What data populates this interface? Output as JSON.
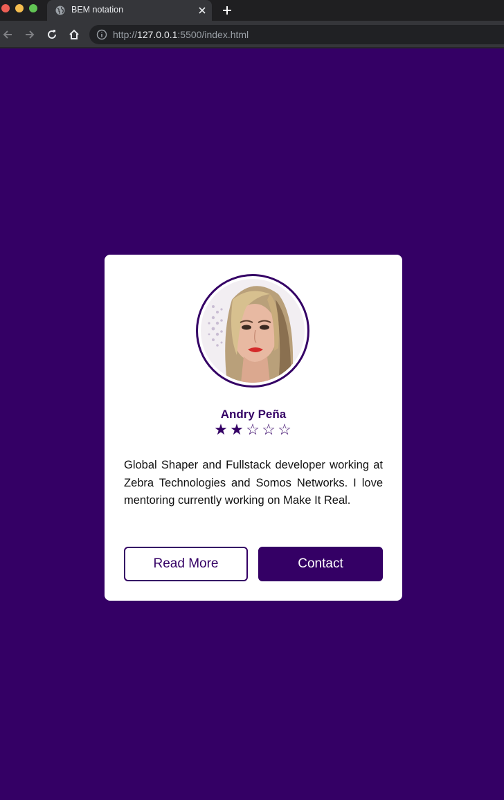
{
  "browser": {
    "tab_title": "BEM notation",
    "url_scheme": "http://",
    "url_host": "127.0.0.1",
    "url_rest": ":5500/index.html"
  },
  "card": {
    "name": "Andry Peña",
    "rating": 2,
    "rating_max": 5,
    "stars": [
      "★",
      "★",
      "☆",
      "☆",
      "☆"
    ],
    "bio": "Global Shaper and Fullstack developer working at Zebra Technologies and Somos Networks. I love mentoring currently working on Make It Real.",
    "read_more_label": "Read More",
    "contact_label": "Contact"
  },
  "colors": {
    "page_background": "#340065",
    "accent": "#340065",
    "card_background": "#ffffff"
  }
}
